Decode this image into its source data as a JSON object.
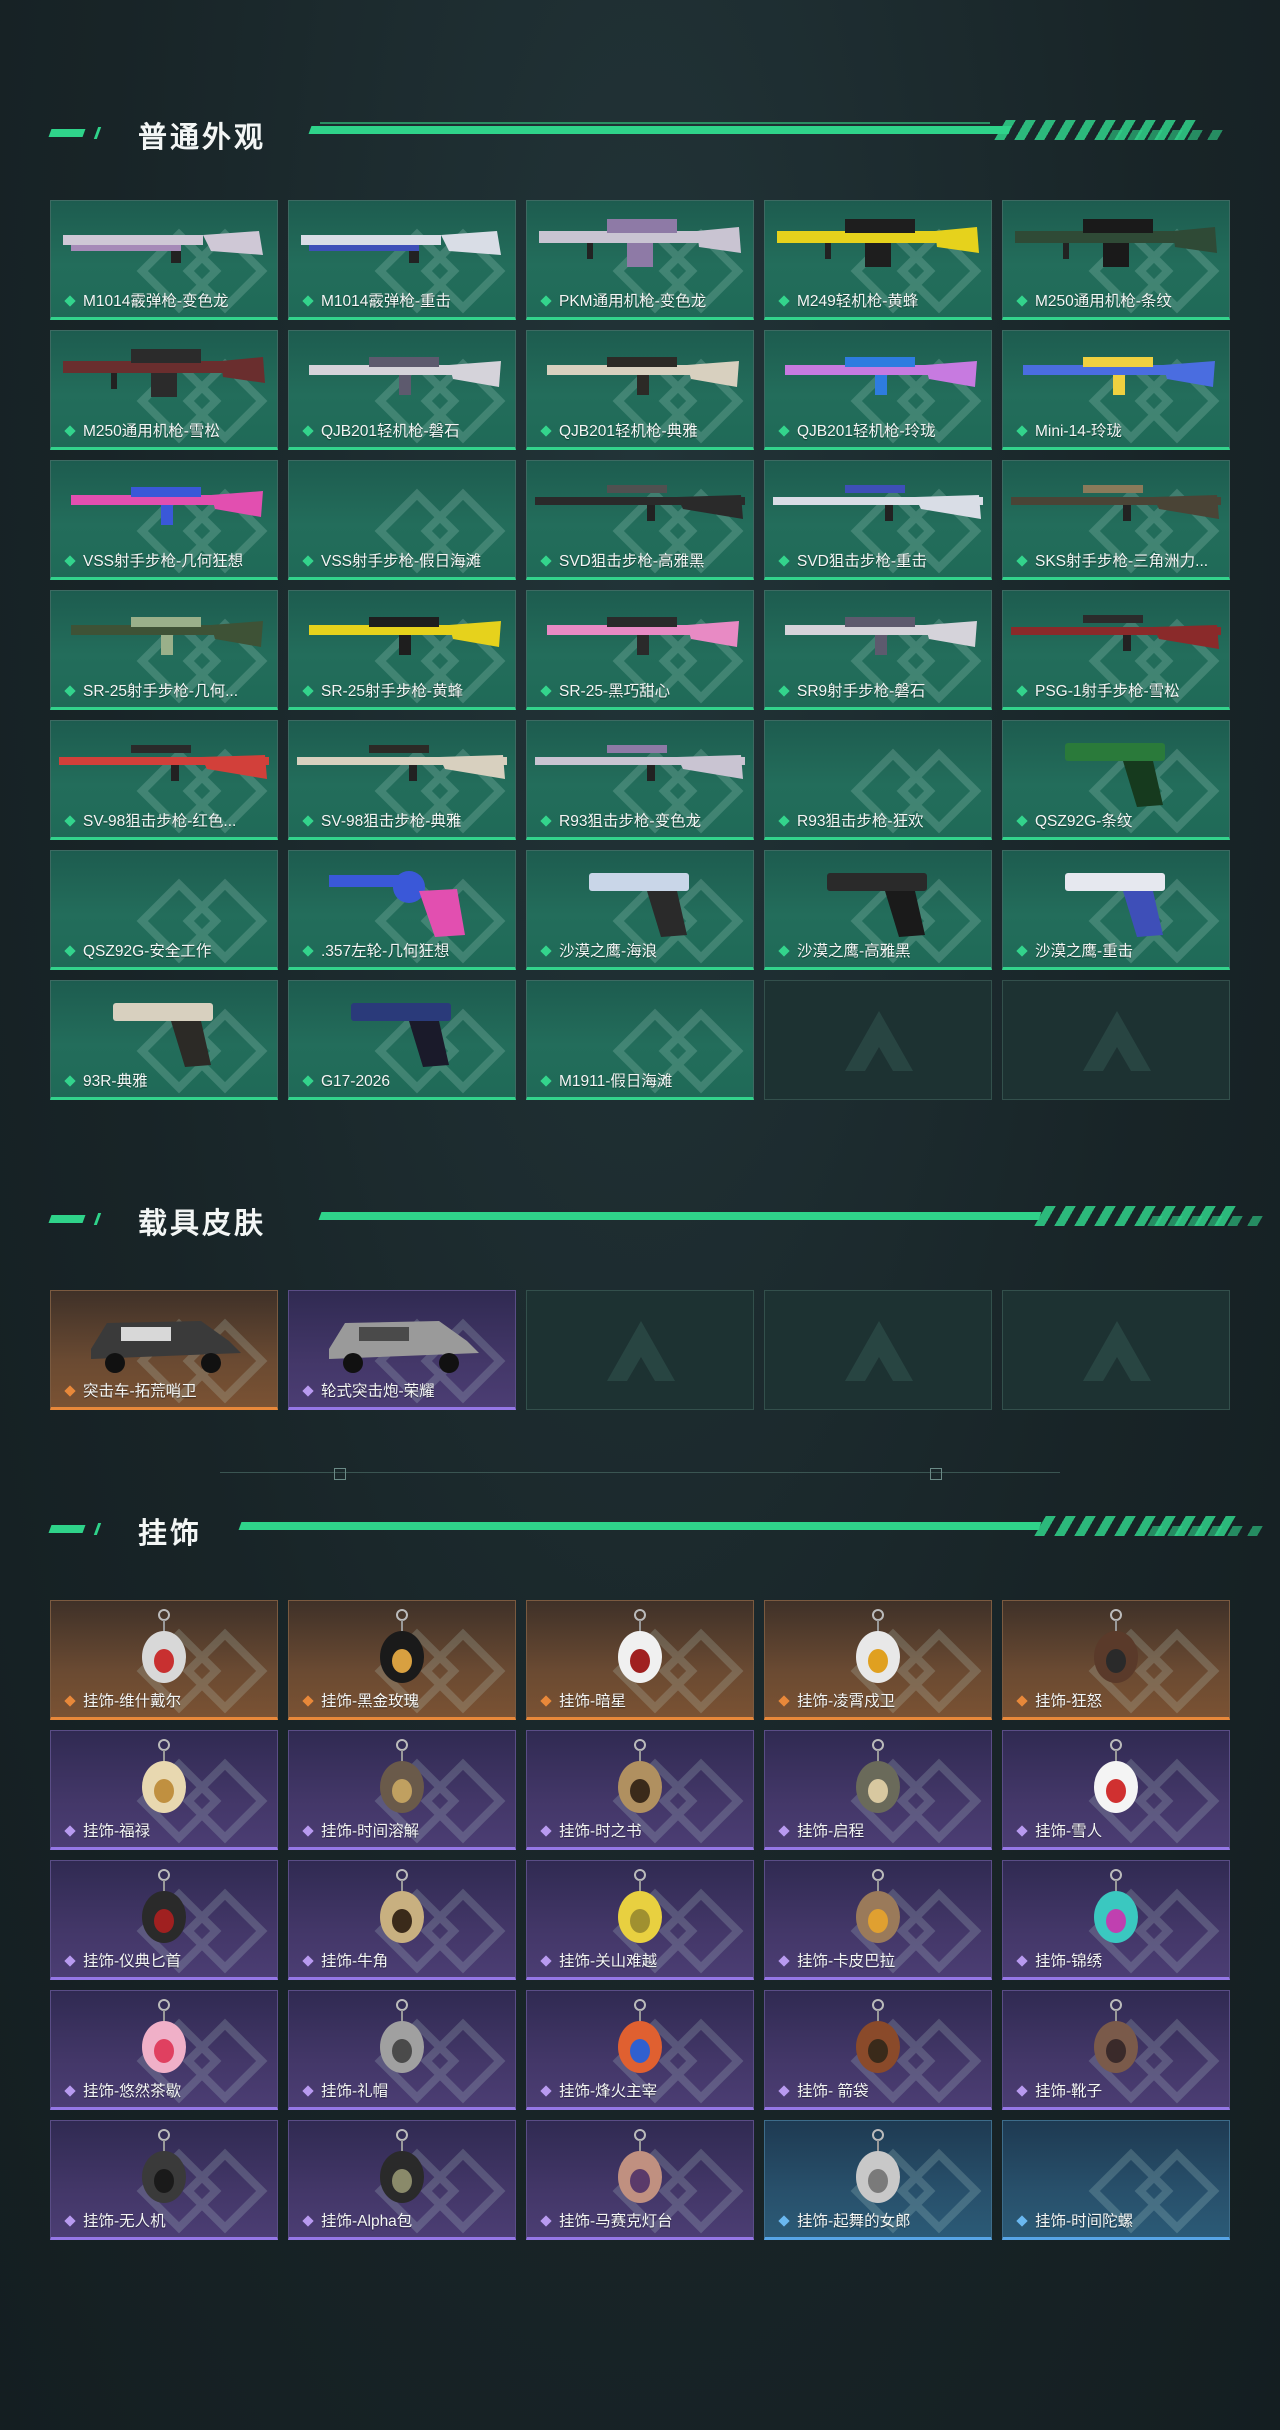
{
  "colors": {
    "accent": "#2fd38a",
    "green_card": "#236d5b",
    "orange_card": "#6a4a32",
    "purple_card": "#433768",
    "blue_card": "#28506b"
  },
  "sections": [
    {
      "title": "普通外观",
      "items": [
        {
          "label": "M1014霰弹枪-变色龙",
          "rarity": "green",
          "img": "shotgun",
          "c1": "#cfc8d6",
          "c2": "#a68ab8"
        },
        {
          "label": "M1014霰弹枪-重击",
          "rarity": "green",
          "img": "shotgun",
          "c1": "#d9dde6",
          "c2": "#3e4fb8"
        },
        {
          "label": "PKM通用机枪-变色龙",
          "rarity": "green",
          "img": "mg",
          "c1": "#c9c4d2",
          "c2": "#8e7aa6"
        },
        {
          "label": "M249轻机枪-黄蜂",
          "rarity": "green",
          "img": "mg",
          "c1": "#e6d21c",
          "c2": "#1e1e1e"
        },
        {
          "label": "M250通用机枪-条纹",
          "rarity": "green",
          "img": "mg",
          "c1": "#2f4a36",
          "c2": "#1a1a1a"
        },
        {
          "label": "M250通用机枪-雪松",
          "rarity": "green",
          "img": "mg",
          "c1": "#6a2e2e",
          "c2": "#2b2b2b"
        },
        {
          "label": "QJB201轻机枪-磐石",
          "rarity": "green",
          "img": "rifle",
          "c1": "#d5d3da",
          "c2": "#5d5a6e"
        },
        {
          "label": "QJB201轻机枪-典雅",
          "rarity": "green",
          "img": "rifle",
          "c1": "#d8d0bf",
          "c2": "#2c2a26"
        },
        {
          "label": "QJB201轻机枪-玲珑",
          "rarity": "green",
          "img": "rifle",
          "c1": "#c77ae0",
          "c2": "#2e7ce0"
        },
        {
          "label": "Mini-14-玲珑",
          "rarity": "green",
          "img": "rifle",
          "c1": "#4a6de0",
          "c2": "#f0d040"
        },
        {
          "label": "VSS射手步枪-几何狂想",
          "rarity": "green",
          "img": "rifle",
          "c1": "#e24fb0",
          "c2": "#3a58d8"
        },
        {
          "label": "VSS射手步枪-假日海滩",
          "rarity": "green",
          "img": "none",
          "c1": "",
          "c2": ""
        },
        {
          "label": "SVD狙击步枪-高雅黑",
          "rarity": "green",
          "img": "sniper",
          "c1": "#2a2a2a",
          "c2": "#505050"
        },
        {
          "label": "SVD狙击步枪-重击",
          "rarity": "green",
          "img": "sniper",
          "c1": "#d9dde6",
          "c2": "#3e4fb8"
        },
        {
          "label": "SKS射手步枪-三角洲力...",
          "rarity": "green",
          "img": "sniper",
          "c1": "#4a4436",
          "c2": "#8a7a5a"
        },
        {
          "label": "SR-25射手步枪-几何...",
          "rarity": "green",
          "img": "rifle",
          "c1": "#3e5236",
          "c2": "#9ab08a"
        },
        {
          "label": "SR-25射手步枪-黄蜂",
          "rarity": "green",
          "img": "rifle",
          "c1": "#e6d21c",
          "c2": "#1e1e1e"
        },
        {
          "label": "SR-25-黑巧甜心",
          "rarity": "green",
          "img": "rifle",
          "c1": "#e88ac4",
          "c2": "#2a2a2a"
        },
        {
          "label": "SR9射手步枪-磐石",
          "rarity": "green",
          "img": "rifle",
          "c1": "#d5d3da",
          "c2": "#5d5a6e"
        },
        {
          "label": "PSG-1射手步枪-雪松",
          "rarity": "green",
          "img": "sniper",
          "c1": "#8a2a2a",
          "c2": "#2b2b2b"
        },
        {
          "label": "SV-98狙击步枪-红色...",
          "rarity": "green",
          "img": "sniper",
          "c1": "#d2403a",
          "c2": "#2a2a2a"
        },
        {
          "label": "SV-98狙击步枪-典雅",
          "rarity": "green",
          "img": "sniper",
          "c1": "#d8d0bf",
          "c2": "#2c2a26"
        },
        {
          "label": "R93狙击步枪-变色龙",
          "rarity": "green",
          "img": "sniper",
          "c1": "#c9c4d2",
          "c2": "#8e7aa6"
        },
        {
          "label": "R93狙击步枪-狂欢",
          "rarity": "green",
          "img": "none",
          "c1": "",
          "c2": ""
        },
        {
          "label": "QSZ92G-条纹",
          "rarity": "green",
          "img": "pistol",
          "c1": "#2a7a3a",
          "c2": "#163a1e"
        },
        {
          "label": "QSZ92G-安全工作",
          "rarity": "green",
          "img": "none",
          "c1": "",
          "c2": ""
        },
        {
          "label": ".357左轮-几何狂想",
          "rarity": "green",
          "img": "revolver",
          "c1": "#3a58d8",
          "c2": "#e24fb0"
        },
        {
          "label": "沙漠之鹰-海浪",
          "rarity": "green",
          "img": "pistol",
          "c1": "#c9d6e8",
          "c2": "#2a2a2a"
        },
        {
          "label": "沙漠之鹰-高雅黑",
          "rarity": "green",
          "img": "pistol",
          "c1": "#2a2a2a",
          "c2": "#1a1a1a"
        },
        {
          "label": "沙漠之鹰-重击",
          "rarity": "green",
          "img": "pistol",
          "c1": "#e6e8ef",
          "c2": "#3e4fb8"
        },
        {
          "label": "93R-典雅",
          "rarity": "green",
          "img": "pistol",
          "c1": "#d8d0bf",
          "c2": "#2c2a26"
        },
        {
          "label": "G17-2026",
          "rarity": "green",
          "img": "pistol",
          "c1": "#2a3a7a",
          "c2": "#1a1a2a"
        },
        {
          "label": "M1911-假日海滩",
          "rarity": "green",
          "img": "none",
          "c1": "",
          "c2": ""
        },
        {
          "label": "",
          "rarity": "empty",
          "img": "none",
          "c1": "",
          "c2": ""
        },
        {
          "label": "",
          "rarity": "empty",
          "img": "none",
          "c1": "",
          "c2": ""
        }
      ]
    },
    {
      "title": "载具皮肤",
      "items": [
        {
          "label": "突击车-拓荒哨卫",
          "rarity": "orange",
          "img": "vehicle",
          "c1": "#3a3a3a",
          "c2": "#d8d8d8"
        },
        {
          "label": "轮式突击炮-荣耀",
          "rarity": "purple",
          "img": "vehicle",
          "c1": "#9a9a9a",
          "c2": "#4a4a4a"
        },
        {
          "label": "",
          "rarity": "empty",
          "img": "none",
          "c1": "",
          "c2": ""
        },
        {
          "label": "",
          "rarity": "empty",
          "img": "none",
          "c1": "",
          "c2": ""
        },
        {
          "label": "",
          "rarity": "empty",
          "img": "none",
          "c1": "",
          "c2": ""
        }
      ]
    },
    {
      "title": "挂饰",
      "items": [
        {
          "label": "挂饰-维什戴尔",
          "rarity": "orange",
          "img": "charm",
          "c1": "#d8d8d8",
          "c2": "#c83030"
        },
        {
          "label": "挂饰-黑金玫瑰",
          "rarity": "orange",
          "img": "charm",
          "c1": "#1a1a1a",
          "c2": "#d8a040"
        },
        {
          "label": "挂饰-暗星",
          "rarity": "orange",
          "img": "charm",
          "c1": "#f0f0f0",
          "c2": "#a02020"
        },
        {
          "label": "挂饰-凌霄戍卫",
          "rarity": "orange",
          "img": "charm",
          "c1": "#e8e8e8",
          "c2": "#e0a020"
        },
        {
          "label": "挂饰-狂怒",
          "rarity": "orange",
          "img": "charm",
          "c1": "#5a3a2a",
          "c2": "#2a2a2a"
        },
        {
          "label": "挂饰-福禄",
          "rarity": "purple",
          "img": "charm",
          "c1": "#e8d8b0",
          "c2": "#c09040"
        },
        {
          "label": "挂饰-时间溶解",
          "rarity": "purple",
          "img": "charm",
          "c1": "#6a5a4a",
          "c2": "#c0a060"
        },
        {
          "label": "挂饰-时之书",
          "rarity": "purple",
          "img": "charm",
          "c1": "#b09060",
          "c2": "#3a2a1a"
        },
        {
          "label": "挂饰-启程",
          "rarity": "purple",
          "img": "charm",
          "c1": "#6a6a5a",
          "c2": "#d8c8a0"
        },
        {
          "label": "挂饰-雪人",
          "rarity": "purple",
          "img": "charm",
          "c1": "#f4f4f4",
          "c2": "#d03030"
        },
        {
          "label": "挂饰-仪典匕首",
          "rarity": "purple",
          "img": "charm",
          "c1": "#2a2a2a",
          "c2": "#a02020"
        },
        {
          "label": "挂饰-牛角",
          "rarity": "purple",
          "img": "charm",
          "c1": "#c8b080",
          "c2": "#3a2a1a"
        },
        {
          "label": "挂饰-关山难越",
          "rarity": "purple",
          "img": "charm",
          "c1": "#e8d040",
          "c2": "#a09030"
        },
        {
          "label": "挂饰-卡皮巴拉",
          "rarity": "purple",
          "img": "charm",
          "c1": "#9a7a5a",
          "c2": "#e0a030"
        },
        {
          "label": "挂饰-锦绣",
          "rarity": "purple",
          "img": "charm",
          "c1": "#3ac8c0",
          "c2": "#c040b0"
        },
        {
          "label": "挂饰-悠然茶歇",
          "rarity": "purple",
          "img": "charm",
          "c1": "#f0b0c8",
          "c2": "#e04060"
        },
        {
          "label": "挂饰-礼帽",
          "rarity": "purple",
          "img": "charm",
          "c1": "#a0a0a0",
          "c2": "#4a4a4a"
        },
        {
          "label": "挂饰-烽火主宰",
          "rarity": "purple",
          "img": "charm",
          "c1": "#e06030",
          "c2": "#3060d0"
        },
        {
          "label": "挂饰- 箭袋",
          "rarity": "purple",
          "img": "charm",
          "c1": "#8a4a2a",
          "c2": "#3a2a1a"
        },
        {
          "label": "挂饰-靴子",
          "rarity": "purple",
          "img": "charm",
          "c1": "#7a5a4a",
          "c2": "#3a2a2a"
        },
        {
          "label": "挂饰-无人机",
          "rarity": "purple",
          "img": "charm",
          "c1": "#3a3a3a",
          "c2": "#1a1a1a"
        },
        {
          "label": "挂饰-Alpha包",
          "rarity": "purple",
          "img": "charm",
          "c1": "#2a2a2a",
          "c2": "#8a8a6a"
        },
        {
          "label": "挂饰-马赛克灯台",
          "rarity": "purple",
          "img": "charm",
          "c1": "#c09080",
          "c2": "#5a3a6a"
        },
        {
          "label": "挂饰-起舞的女郎",
          "rarity": "blue",
          "img": "charm",
          "c1": "#c8c8c8",
          "c2": "#7a7a7a"
        },
        {
          "label": "挂饰-时间陀螺",
          "rarity": "blue",
          "img": "none",
          "c1": "",
          "c2": ""
        }
      ]
    }
  ]
}
